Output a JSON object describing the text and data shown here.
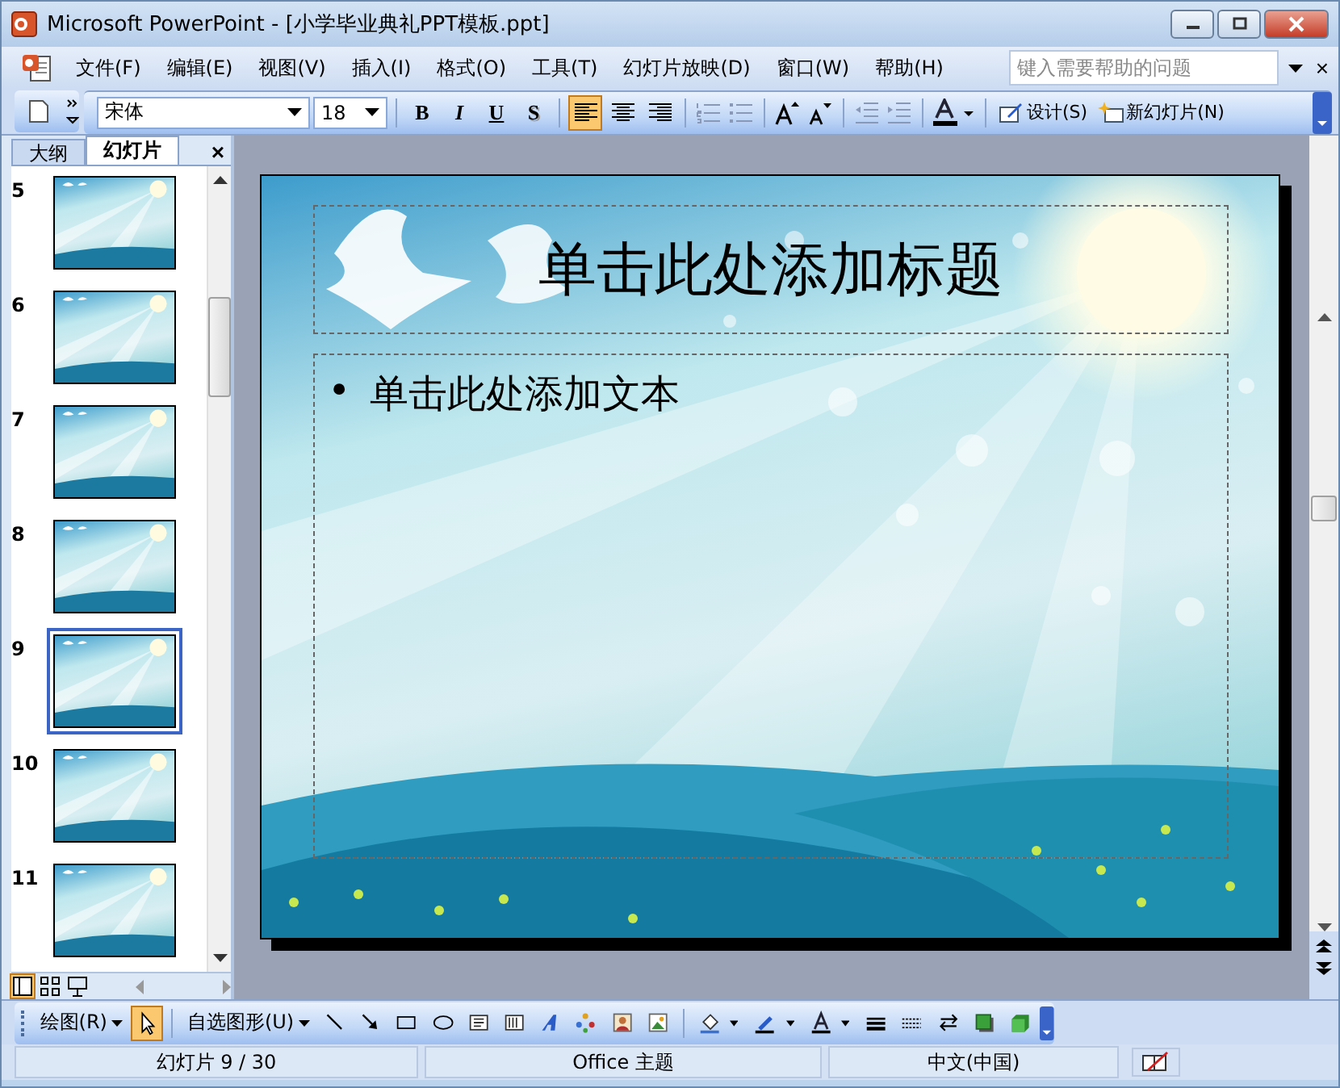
{
  "window": {
    "title": "Microsoft PowerPoint - [小学毕业典礼PPT模板.ppt]"
  },
  "menu": {
    "items": [
      {
        "label": "文件(F)"
      },
      {
        "label": "编辑(E)"
      },
      {
        "label": "视图(V)"
      },
      {
        "label": "插入(I)"
      },
      {
        "label": "格式(O)"
      },
      {
        "label": "工具(T)"
      },
      {
        "label": "幻灯片放映(D)"
      },
      {
        "label": "窗口(W)"
      },
      {
        "label": "帮助(H)"
      }
    ],
    "help_field": {
      "placeholder": "键入需要帮助的问题"
    },
    "close": "×"
  },
  "toolbar": {
    "font": "宋体",
    "size": "18",
    "styles": [
      {
        "label": "B"
      },
      {
        "label": "I"
      },
      {
        "label": "U"
      },
      {
        "label": "S"
      }
    ],
    "align": [
      {
        "selected": true
      },
      {
        "selected": false
      },
      {
        "selected": false
      }
    ],
    "commands": [
      {
        "label": "设计(S)"
      },
      {
        "label": "新幻灯片(N)"
      }
    ]
  },
  "panel": {
    "tabs": [
      {
        "label": "大纲",
        "selected": false
      },
      {
        "label": "幻灯片",
        "selected": true
      }
    ],
    "close": "×",
    "slides": [
      {
        "number": "5",
        "selected": false
      },
      {
        "number": "6",
        "selected": false
      },
      {
        "number": "7",
        "selected": false
      },
      {
        "number": "8",
        "selected": false
      },
      {
        "number": "9",
        "selected": true
      },
      {
        "number": "10",
        "selected": false
      },
      {
        "number": "11",
        "selected": false
      }
    ]
  },
  "slide": {
    "title": "单击此处添加标题",
    "bullet": "•",
    "body": "单击此处添加文本"
  },
  "drawing_toolbar": {
    "menus": [
      {
        "label": "绘图(R)"
      },
      {
        "label": "自选图形(U)"
      }
    ],
    "pointer": {
      "selected": true
    }
  },
  "status_bar": {
    "cells": [
      "幻灯片 9 / 30",
      "Office 主题",
      "中文(中国)"
    ]
  }
}
